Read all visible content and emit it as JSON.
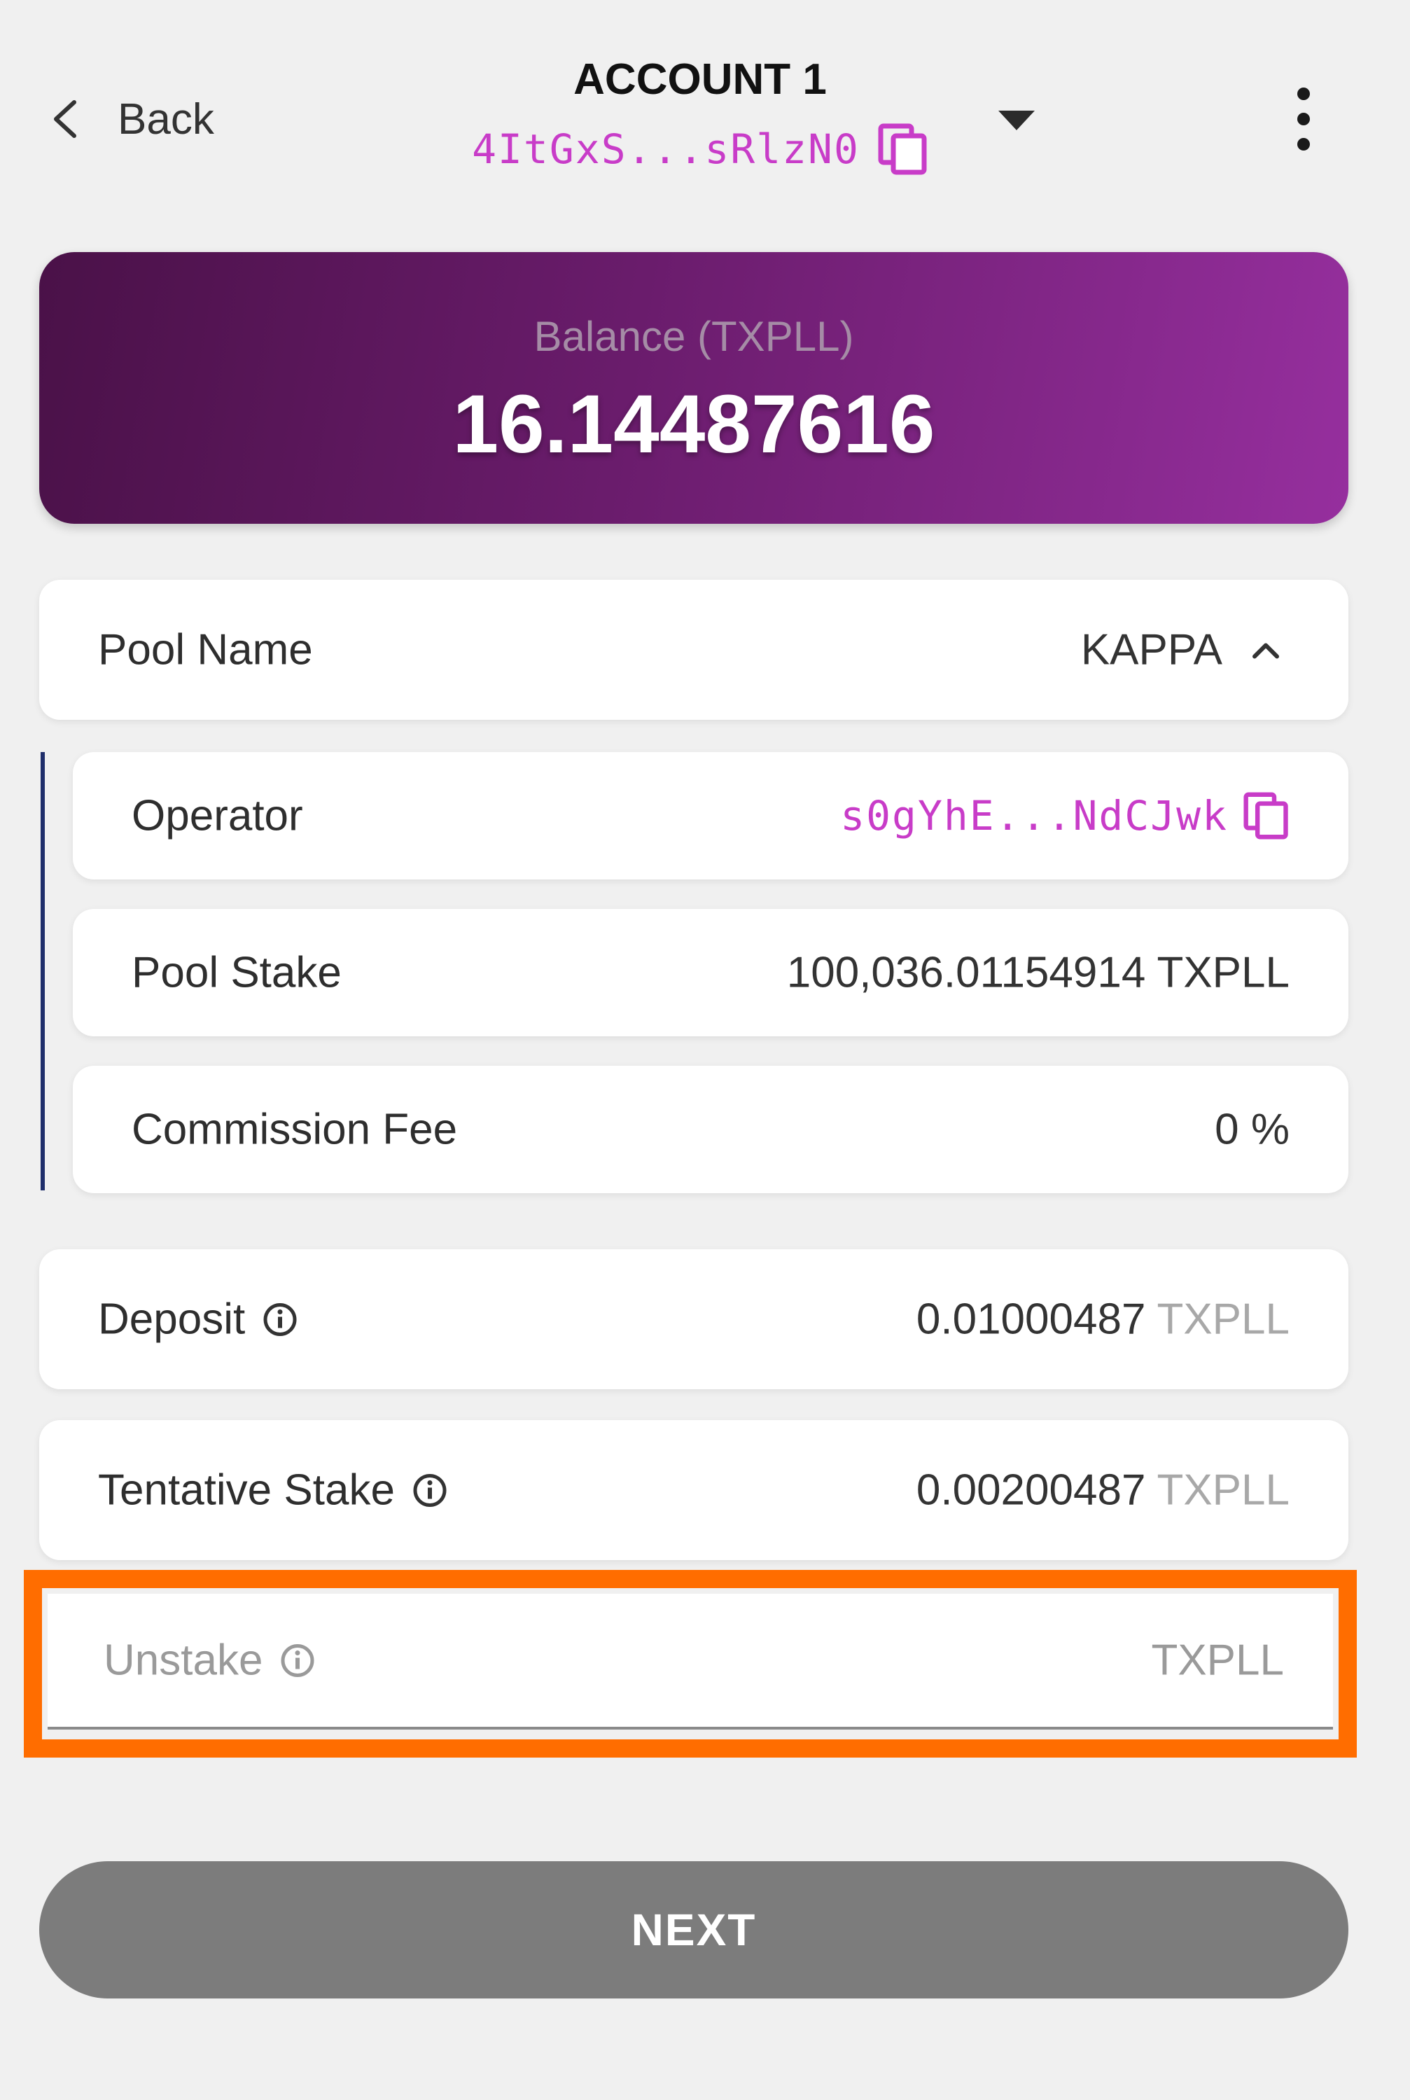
{
  "header": {
    "back_label": "Back",
    "account_title": "ACCOUNT 1",
    "account_address": "4ItGxS...sRlzN0",
    "icons": {
      "back": "chevron-left-icon",
      "copy": "copy-icon",
      "dropdown": "caret-down-icon",
      "more": "more-vertical-icon"
    }
  },
  "balance": {
    "label": "Balance (TXPLL)",
    "value": "16.14487616"
  },
  "pool": {
    "label": "Pool Name",
    "value": "KAPPA",
    "details": {
      "operator_label": "Operator",
      "operator_value": "s0gYhE...NdCJwk",
      "stake_label": "Pool Stake",
      "stake_value": "100,036.01154914 TXPLL",
      "fee_label": "Commission Fee",
      "fee_value": "0 %"
    }
  },
  "deposit": {
    "label": "Deposit",
    "value": "0.01000487",
    "unit": "TXPLL"
  },
  "tentative": {
    "label": "Tentative Stake",
    "value": "0.00200487",
    "unit": "TXPLL"
  },
  "unstake": {
    "label": "Unstake",
    "value": "",
    "unit": "TXPLL"
  },
  "next_button": {
    "label": "NEXT"
  },
  "colors": {
    "accent_address": "#c83cc8",
    "highlight": "#ff6d00",
    "balance_gradient_start": "#4a1148",
    "balance_gradient_end": "#962f9e",
    "button_disabled": "#7c7c7c",
    "tree_line": "#1f2e6b"
  }
}
